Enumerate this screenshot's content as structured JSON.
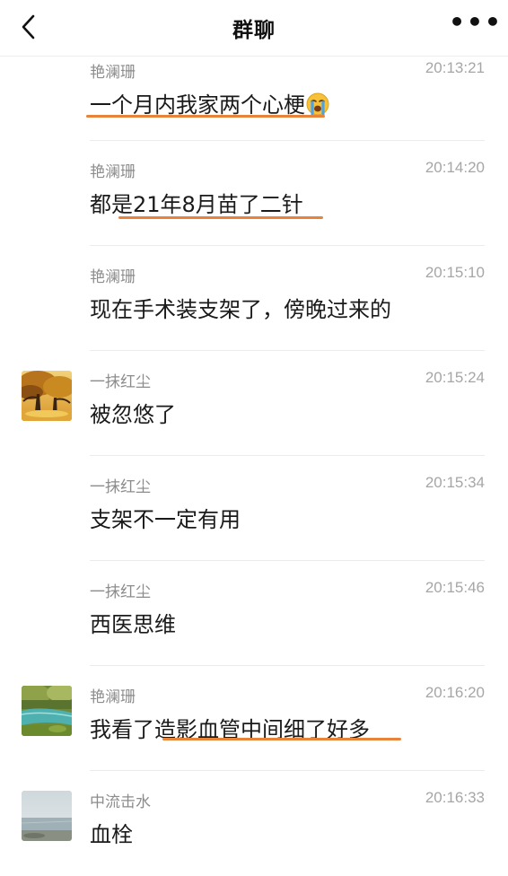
{
  "nav": {
    "title": "群聊",
    "back_icon": "chevron-left-icon",
    "more_icon": "more-horizontal-icon",
    "more_glyph": "•••"
  },
  "messages": [
    {
      "sender": "艳澜珊",
      "time": "20:13:21",
      "text": "一个月内我家两个心梗",
      "emoji": "loudly-crying-face",
      "underline": "一个月内我家两个心梗",
      "has_avatar": false
    },
    {
      "sender": "艳澜珊",
      "time": "20:14:20",
      "text": "都是21年8月苗了二针",
      "underline": "21年8月苗了二针",
      "has_avatar": false
    },
    {
      "sender": "艳澜珊",
      "time": "20:15:10",
      "text": "现在手术装支架了，傍晚过来的",
      "has_avatar": false
    },
    {
      "sender": "一抹红尘",
      "time": "20:15:24",
      "text": "被忽悠了",
      "has_avatar": true,
      "avatar": "autumn-trees-avatar"
    },
    {
      "sender": "一抹红尘",
      "time": "20:15:34",
      "text": "支架不一定有用",
      "has_avatar": false
    },
    {
      "sender": "一抹红尘",
      "time": "20:15:46",
      "text": "西医思维",
      "has_avatar": false
    },
    {
      "sender": "艳澜珊",
      "time": "20:16:20",
      "text": "我看了造影血管中间细了好多",
      "underline": "造影血管中间细了好多",
      "has_avatar": true,
      "avatar": "stream-landscape-avatar"
    },
    {
      "sender": "中流击水",
      "time": "20:16:33",
      "text": "血栓",
      "has_avatar": true,
      "avatar": "lake-landscape-avatar"
    }
  ],
  "colors": {
    "underline": "#e8833a",
    "sender": "#8c8c8c",
    "time": "#a6a6a6",
    "divider": "#ebebeb"
  }
}
